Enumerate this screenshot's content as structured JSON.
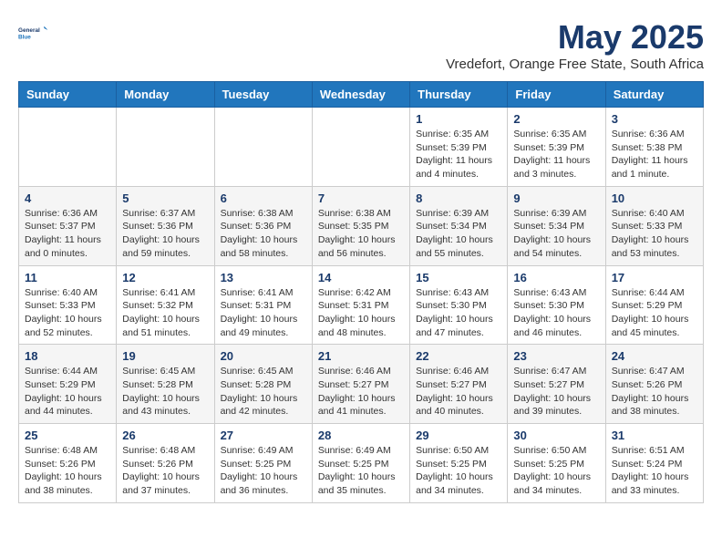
{
  "logo": {
    "line1": "General",
    "line2": "Blue"
  },
  "title": "May 2025",
  "subtitle": "Vredefort, Orange Free State, South Africa",
  "days_of_week": [
    "Sunday",
    "Monday",
    "Tuesday",
    "Wednesday",
    "Thursday",
    "Friday",
    "Saturday"
  ],
  "weeks": [
    [
      {
        "day": "",
        "info": ""
      },
      {
        "day": "",
        "info": ""
      },
      {
        "day": "",
        "info": ""
      },
      {
        "day": "",
        "info": ""
      },
      {
        "day": "1",
        "info": "Sunrise: 6:35 AM\nSunset: 5:39 PM\nDaylight: 11 hours\nand 4 minutes."
      },
      {
        "day": "2",
        "info": "Sunrise: 6:35 AM\nSunset: 5:39 PM\nDaylight: 11 hours\nand 3 minutes."
      },
      {
        "day": "3",
        "info": "Sunrise: 6:36 AM\nSunset: 5:38 PM\nDaylight: 11 hours\nand 1 minute."
      }
    ],
    [
      {
        "day": "4",
        "info": "Sunrise: 6:36 AM\nSunset: 5:37 PM\nDaylight: 11 hours\nand 0 minutes."
      },
      {
        "day": "5",
        "info": "Sunrise: 6:37 AM\nSunset: 5:36 PM\nDaylight: 10 hours\nand 59 minutes."
      },
      {
        "day": "6",
        "info": "Sunrise: 6:38 AM\nSunset: 5:36 PM\nDaylight: 10 hours\nand 58 minutes."
      },
      {
        "day": "7",
        "info": "Sunrise: 6:38 AM\nSunset: 5:35 PM\nDaylight: 10 hours\nand 56 minutes."
      },
      {
        "day": "8",
        "info": "Sunrise: 6:39 AM\nSunset: 5:34 PM\nDaylight: 10 hours\nand 55 minutes."
      },
      {
        "day": "9",
        "info": "Sunrise: 6:39 AM\nSunset: 5:34 PM\nDaylight: 10 hours\nand 54 minutes."
      },
      {
        "day": "10",
        "info": "Sunrise: 6:40 AM\nSunset: 5:33 PM\nDaylight: 10 hours\nand 53 minutes."
      }
    ],
    [
      {
        "day": "11",
        "info": "Sunrise: 6:40 AM\nSunset: 5:33 PM\nDaylight: 10 hours\nand 52 minutes."
      },
      {
        "day": "12",
        "info": "Sunrise: 6:41 AM\nSunset: 5:32 PM\nDaylight: 10 hours\nand 51 minutes."
      },
      {
        "day": "13",
        "info": "Sunrise: 6:41 AM\nSunset: 5:31 PM\nDaylight: 10 hours\nand 49 minutes."
      },
      {
        "day": "14",
        "info": "Sunrise: 6:42 AM\nSunset: 5:31 PM\nDaylight: 10 hours\nand 48 minutes."
      },
      {
        "day": "15",
        "info": "Sunrise: 6:43 AM\nSunset: 5:30 PM\nDaylight: 10 hours\nand 47 minutes."
      },
      {
        "day": "16",
        "info": "Sunrise: 6:43 AM\nSunset: 5:30 PM\nDaylight: 10 hours\nand 46 minutes."
      },
      {
        "day": "17",
        "info": "Sunrise: 6:44 AM\nSunset: 5:29 PM\nDaylight: 10 hours\nand 45 minutes."
      }
    ],
    [
      {
        "day": "18",
        "info": "Sunrise: 6:44 AM\nSunset: 5:29 PM\nDaylight: 10 hours\nand 44 minutes."
      },
      {
        "day": "19",
        "info": "Sunrise: 6:45 AM\nSunset: 5:28 PM\nDaylight: 10 hours\nand 43 minutes."
      },
      {
        "day": "20",
        "info": "Sunrise: 6:45 AM\nSunset: 5:28 PM\nDaylight: 10 hours\nand 42 minutes."
      },
      {
        "day": "21",
        "info": "Sunrise: 6:46 AM\nSunset: 5:27 PM\nDaylight: 10 hours\nand 41 minutes."
      },
      {
        "day": "22",
        "info": "Sunrise: 6:46 AM\nSunset: 5:27 PM\nDaylight: 10 hours\nand 40 minutes."
      },
      {
        "day": "23",
        "info": "Sunrise: 6:47 AM\nSunset: 5:27 PM\nDaylight: 10 hours\nand 39 minutes."
      },
      {
        "day": "24",
        "info": "Sunrise: 6:47 AM\nSunset: 5:26 PM\nDaylight: 10 hours\nand 38 minutes."
      }
    ],
    [
      {
        "day": "25",
        "info": "Sunrise: 6:48 AM\nSunset: 5:26 PM\nDaylight: 10 hours\nand 38 minutes."
      },
      {
        "day": "26",
        "info": "Sunrise: 6:48 AM\nSunset: 5:26 PM\nDaylight: 10 hours\nand 37 minutes."
      },
      {
        "day": "27",
        "info": "Sunrise: 6:49 AM\nSunset: 5:25 PM\nDaylight: 10 hours\nand 36 minutes."
      },
      {
        "day": "28",
        "info": "Sunrise: 6:49 AM\nSunset: 5:25 PM\nDaylight: 10 hours\nand 35 minutes."
      },
      {
        "day": "29",
        "info": "Sunrise: 6:50 AM\nSunset: 5:25 PM\nDaylight: 10 hours\nand 34 minutes."
      },
      {
        "day": "30",
        "info": "Sunrise: 6:50 AM\nSunset: 5:25 PM\nDaylight: 10 hours\nand 34 minutes."
      },
      {
        "day": "31",
        "info": "Sunrise: 6:51 AM\nSunset: 5:24 PM\nDaylight: 10 hours\nand 33 minutes."
      }
    ]
  ],
  "colors": {
    "header_bg": "#2176bd",
    "title_color": "#1a3a6b"
  }
}
